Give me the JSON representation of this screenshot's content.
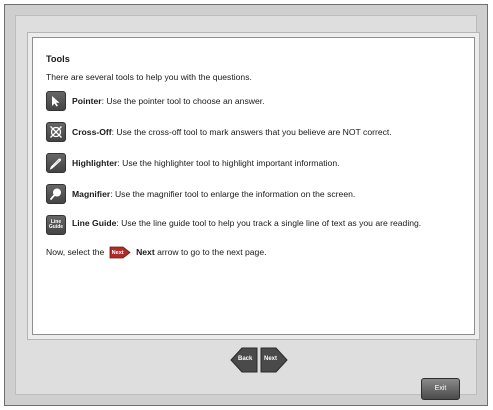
{
  "panel": {
    "title": "Tools",
    "intro": "There are several tools to help you with the questions.",
    "tools": [
      {
        "icon": "pointer-icon",
        "name": "Pointer",
        "description": ": Use the pointer tool to choose an answer."
      },
      {
        "icon": "cross-off-icon",
        "name": "Cross-Off",
        "description": ": Use the cross-off tool to mark answers that you believe are NOT correct."
      },
      {
        "icon": "highlighter-icon",
        "name": "Highlighter",
        "description": ": Use the highlighter tool to highlight important information."
      },
      {
        "icon": "magnifier-icon",
        "name": "Magnifier",
        "description": ": Use the magnifier tool to enlarge the information on the screen."
      },
      {
        "icon": "line-guide-icon",
        "icon_label_top": "Line",
        "icon_label_bottom": "Guide",
        "name": "Line Guide",
        "description": ": Use the line guide tool to help you track a single line of text as you are reading."
      }
    ],
    "instruction_prefix": "Now, select the",
    "instruction_icon_label": "Next",
    "instruction_bold": "Next",
    "instruction_suffix": "arrow to go to the next page."
  },
  "nav": {
    "back_label": "Back",
    "next_label": "Next"
  },
  "exit_label": "Exit",
  "colors": {
    "frame_bg": "#cfcfcf",
    "panel_bg": "#ffffff",
    "button_dark": "#4a4a4a"
  }
}
